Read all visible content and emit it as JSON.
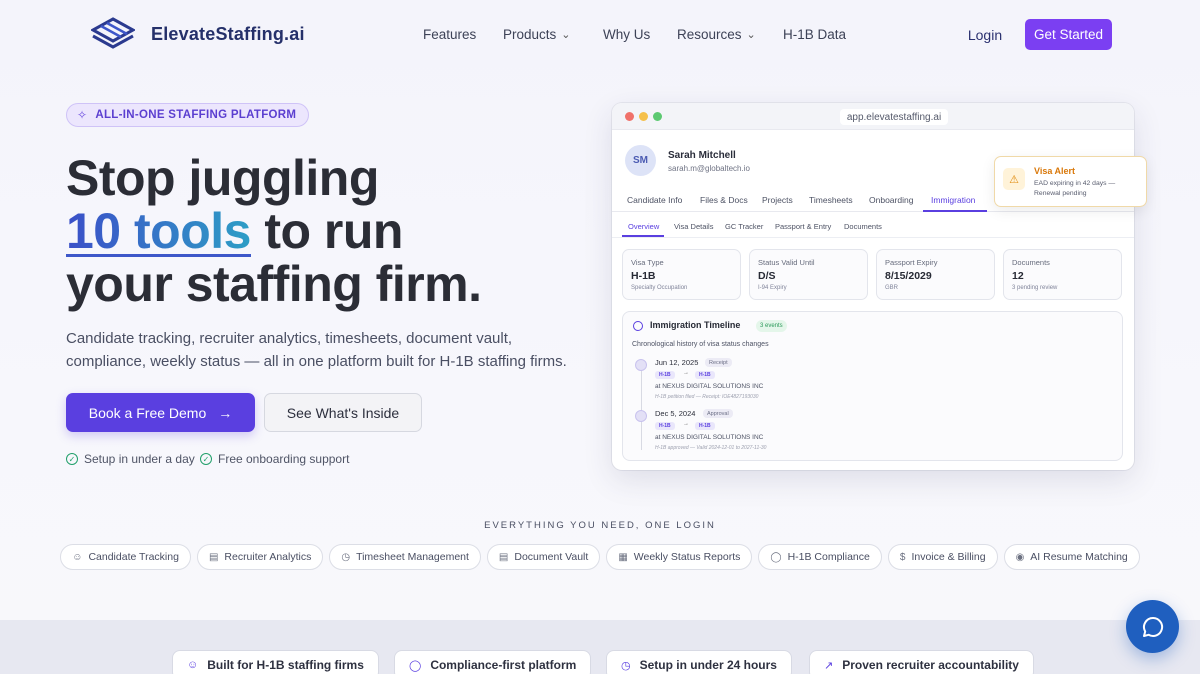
{
  "brand": {
    "name": "ElevateStaffing.ai",
    "colors": {
      "accent": "#7b3ff2",
      "primary": "#5a3fe0",
      "navy": "#25306a",
      "success": "#22a06b",
      "warning": "#d9780a"
    }
  },
  "nav": {
    "items": [
      {
        "label": "Features",
        "dropdown": false
      },
      {
        "label": "Products",
        "dropdown": true
      },
      {
        "label": "Why Us",
        "dropdown": false
      },
      {
        "label": "Resources",
        "dropdown": true
      },
      {
        "label": "H-1B Data",
        "dropdown": false
      }
    ],
    "login": "Login",
    "get_started": "Get Started"
  },
  "hero": {
    "badge": "ALL-IN-ONE STAFFING PLATFORM",
    "line1": "Stop juggling",
    "highlight": "10 tools",
    "line2_rest": " to run",
    "line3": "your staffing firm.",
    "subtitle": "Candidate tracking, recruiter analytics, timesheets, document vault, compliance, weekly status — all in one platform built for H-1B staffing firms.",
    "cta_primary": "Book a Free Demo",
    "cta_secondary": "See What's Inside",
    "checks": [
      "Setup in under a day",
      "Free onboarding support"
    ]
  },
  "app": {
    "url": "app.elevatestaffing.ai",
    "profile": {
      "initials": "SM",
      "name": "Sarah Mitchell",
      "email": "sarah.m@globaltech.io"
    },
    "tabs": [
      "Candidate Info",
      "Files & Docs",
      "Projects",
      "Timesheets",
      "Onboarding",
      "Immigration"
    ],
    "active_tab": "Immigration",
    "subtabs": [
      "Overview",
      "Visa Details",
      "GC Tracker",
      "Passport & Entry",
      "Documents"
    ],
    "active_subtab": "Overview",
    "cards": [
      {
        "label": "Visa Type",
        "value": "H-1B",
        "sub": "Specialty Occupation"
      },
      {
        "label": "Status Valid Until",
        "value": "D/S",
        "sub": "I-94 Expiry"
      },
      {
        "label": "Passport Expiry",
        "value": "8/15/2029",
        "sub": "GBR"
      },
      {
        "label": "Documents",
        "value": "12",
        "sub": "3 pending review"
      }
    ],
    "timeline": {
      "title": "Immigration Timeline",
      "count": "3 events",
      "desc": "Chronological history of visa status changes",
      "events": [
        {
          "date": "Jun 12, 2025",
          "type": "Receipt",
          "from": "H-1B",
          "to": "H-1B",
          "company": "at NEXUS DIGITAL SOLUTIONS INC",
          "note": "H-1B petition filed — Receipt: IOE4827193030"
        },
        {
          "date": "Dec 5, 2024",
          "type": "Approval",
          "from": "H-1B",
          "to": "H-1B",
          "company": "at NEXUS DIGITAL SOLUTIONS INC",
          "note": "H-1B approved — Valid 2024-12-01 to 2027-11-30"
        }
      ]
    }
  },
  "alert": {
    "title": "Visa Alert",
    "text": "EAD expiring in 42 days — Renewal pending",
    "icon": "warning-icon"
  },
  "features": {
    "heading": "EVERYTHING YOU NEED, ONE LOGIN",
    "items": [
      {
        "label": "Candidate Tracking",
        "icon": "users-icon"
      },
      {
        "label": "Recruiter Analytics",
        "icon": "bar-chart-icon"
      },
      {
        "label": "Timesheet Management",
        "icon": "clock-icon"
      },
      {
        "label": "Document Vault",
        "icon": "file-icon"
      },
      {
        "label": "Weekly Status Reports",
        "icon": "calendar-icon"
      },
      {
        "label": "H-1B Compliance",
        "icon": "shield-icon"
      },
      {
        "label": "Invoice & Billing",
        "icon": "dollar-icon"
      },
      {
        "label": "AI Resume Matching",
        "icon": "ai-icon"
      }
    ]
  },
  "trust": [
    {
      "label": "Built for H-1B staffing firms",
      "icon": "users-icon"
    },
    {
      "label": "Compliance-first platform",
      "icon": "shield-icon"
    },
    {
      "label": "Setup in under 24 hours",
      "icon": "clock-icon"
    },
    {
      "label": "Proven recruiter accountability",
      "icon": "trend-icon"
    }
  ],
  "chat": {
    "icon": "chat-icon"
  }
}
